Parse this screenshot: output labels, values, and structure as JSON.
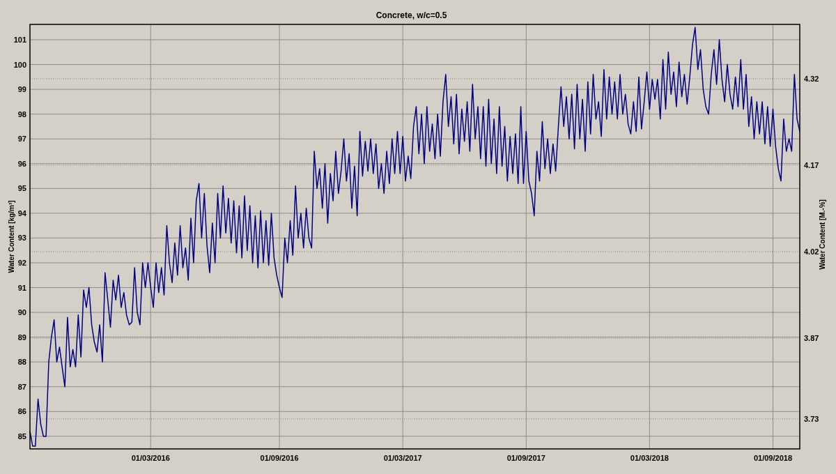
{
  "chart": {
    "chart_data": {
      "type": "line",
      "title": "Concrete, w/c=0.5",
      "ylabel": "Water Content [kg/m³]",
      "categories": [
        null,
        null,
        null,
        null,
        null,
        null,
        null,
        null,
        null,
        null,
        null,
        null,
        null,
        null,
        null,
        null,
        null,
        null,
        null,
        null,
        null,
        null,
        null,
        null,
        null,
        null,
        null,
        null,
        null,
        null,
        null,
        null,
        null,
        null,
        null,
        null,
        null,
        null,
        null,
        null,
        null,
        null,
        null,
        null,
        null,
        "01/03/2016",
        null,
        null,
        null,
        null,
        null,
        null,
        null,
        null,
        null,
        null,
        null,
        null,
        null,
        null,
        null,
        null,
        null,
        null,
        null,
        null,
        null,
        null,
        null,
        null,
        null,
        null,
        null,
        null,
        null,
        null,
        null,
        null,
        null,
        null,
        null,
        null,
        null,
        null,
        null,
        null,
        null,
        null,
        null,
        null,
        null,
        null,
        null,
        "01/09/2016",
        null,
        null,
        null,
        null,
        null,
        null,
        null,
        null,
        null,
        null,
        null,
        null,
        null,
        null,
        null,
        null,
        null,
        null,
        null,
        null,
        null,
        null,
        null,
        null,
        null,
        null,
        null,
        null,
        null,
        null,
        null,
        null,
        null,
        null,
        null,
        null,
        null,
        null,
        null,
        null,
        null,
        null,
        null,
        null,
        null,
        "01/03/2017",
        null,
        null,
        null,
        null,
        null,
        null,
        null,
        null,
        null,
        null,
        null,
        null,
        null,
        null,
        null,
        null,
        null,
        null,
        null,
        null,
        null,
        null,
        null,
        null,
        null,
        null,
        null,
        null,
        null,
        null,
        null,
        null,
        null,
        null,
        null,
        null,
        null,
        null,
        null,
        null,
        null,
        null,
        null,
        null,
        null,
        "01/09/2017",
        null,
        null,
        null,
        null,
        null,
        null,
        null,
        null,
        null,
        null,
        null,
        null,
        null,
        null,
        null,
        null,
        null,
        null,
        null,
        null,
        null,
        null,
        null,
        null,
        null,
        null,
        null,
        null,
        null,
        null,
        null,
        null,
        null,
        null,
        null,
        null,
        null,
        null,
        null,
        null,
        null,
        null,
        null,
        null,
        null,
        "01/03/2018",
        null,
        null,
        null,
        null,
        null,
        null,
        null,
        null,
        null,
        null,
        null,
        null,
        null,
        null,
        null,
        null,
        null,
        null,
        null,
        null,
        null,
        null,
        null,
        null,
        null,
        null,
        null,
        null,
        null,
        null,
        null,
        null,
        null,
        null,
        null,
        null,
        null,
        null,
        null,
        null,
        null,
        null,
        null,
        null,
        null,
        "01/09/2018",
        null,
        null,
        null,
        null,
        null,
        null,
        null,
        null,
        null,
        null
      ],
      "series": [
        {
          "color": "#000080",
          "values": [
            85.2,
            84.6,
            84.6,
            86.5,
            85.5,
            85.0,
            85.0,
            88,
            89,
            89.7,
            88,
            88.6,
            87.8,
            87,
            89.8,
            87.8,
            88.5,
            87.8,
            89.9,
            88.2,
            90.9,
            90.2,
            91,
            89.5,
            88.8,
            88.4,
            89.5,
            88,
            91.6,
            90.5,
            89.4,
            91.3,
            90.5,
            91.5,
            90.2,
            90.8,
            89.9,
            89.5,
            89.6,
            91.8,
            90,
            89.5,
            92,
            91,
            92,
            91,
            90.2,
            92,
            90.8,
            91.8,
            90.7,
            93.5,
            92,
            91.2,
            92.8,
            91.5,
            93.5,
            91.8,
            92.6,
            91.3,
            93.8,
            92,
            94.5,
            95.2,
            93,
            94.8,
            92.7,
            91.6,
            93.6,
            92,
            94.8,
            93,
            95.1,
            93.2,
            94.6,
            92.8,
            94.5,
            92.4,
            94.3,
            92.2,
            94.7,
            92.5,
            94.3,
            92,
            93.9,
            91.8,
            94.1,
            92,
            93.7,
            91.9,
            94,
            92.2,
            91.5,
            91.0,
            90.6,
            93,
            92,
            93.7,
            92.3,
            95.1,
            93,
            94,
            92.6,
            94.2,
            93,
            92.6,
            96.5,
            95,
            95.8,
            94.2,
            96,
            93.6,
            95.6,
            94.5,
            96.5,
            94.8,
            95.7,
            97,
            95.3,
            96.4,
            94.2,
            95.9,
            93.9,
            97.3,
            95.5,
            96.9,
            95.7,
            97,
            95.6,
            96.8,
            95,
            96,
            94.8,
            96.5,
            95.2,
            97,
            95.6,
            97.3,
            95.6,
            97.1,
            95.3,
            96.3,
            95.4,
            97.5,
            98.3,
            96.4,
            98,
            96,
            98.3,
            96.5,
            97.6,
            96.2,
            98,
            96.3,
            98.5,
            99.6,
            97.5,
            98.7,
            96.8,
            98.8,
            96.4,
            98.2,
            96.9,
            98.5,
            96.5,
            99.2,
            97,
            98.3,
            96.2,
            98.3,
            95.9,
            98.6,
            96,
            97.8,
            95.6,
            98.3,
            95.9,
            97.5,
            95.3,
            97.1,
            95.6,
            97.2,
            95.2,
            98.3,
            95.2,
            97.3,
            95.3,
            94.8,
            93.9,
            96.5,
            95.3,
            97.7,
            95.8,
            97,
            95.6,
            96.8,
            95.7,
            97.5,
            99.1,
            97.5,
            98.7,
            97,
            98.8,
            96.6,
            99.2,
            97,
            98.6,
            96.5,
            99.3,
            97.2,
            99.6,
            97.8,
            98.5,
            97.1,
            99.8,
            97.8,
            99.5,
            98,
            99.3,
            97.8,
            99.6,
            98,
            98.8,
            97.6,
            97.2,
            98.5,
            97.3,
            99.5,
            97.4,
            98.5,
            99.7,
            98.2,
            99.4,
            98.6,
            99.4,
            97.8,
            100.2,
            98.2,
            100.5,
            98.8,
            99.7,
            98.3,
            100.1,
            98.7,
            99.6,
            98.4,
            99.5,
            100.8,
            101.5,
            99.8,
            100.6,
            99,
            98.3,
            98,
            99.6,
            100.6,
            99.2,
            101,
            99.4,
            98.5,
            100,
            98.8,
            98.2,
            99.5,
            98.3,
            100.2,
            98.2,
            99.6,
            97.5,
            98.7,
            97,
            98.5,
            97.2,
            98.5,
            96.8,
            98.3,
            96.7,
            98.2,
            96.7,
            95.8,
            95.3,
            97.8,
            96.5,
            97,
            96.5,
            99.6,
            97.8,
            97.3
          ]
        }
      ],
      "ylim": [
        84.49,
        101.62
      ],
      "grid": true,
      "yticks": [
        85,
        86,
        87,
        88,
        89,
        90,
        91,
        92,
        93,
        94,
        95,
        96,
        97,
        98,
        99,
        100,
        101
      ]
    },
    "right_axis": {
      "label": "Water Content [M.-%]",
      "ticks": [
        "4.32",
        "4.17",
        "4.02",
        "3.87",
        "3.73"
      ]
    }
  }
}
